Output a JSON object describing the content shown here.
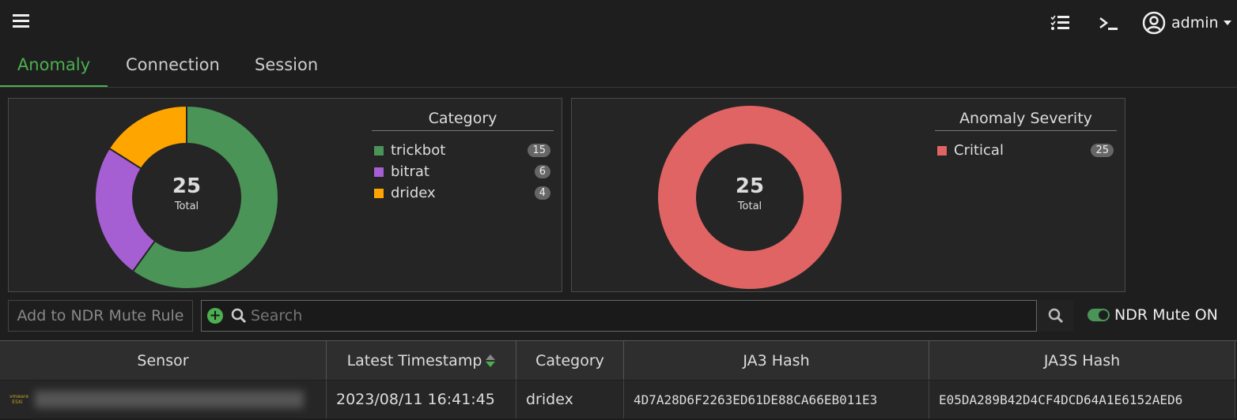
{
  "header": {
    "user": "admin"
  },
  "tabs": [
    {
      "label": "Anomaly"
    },
    {
      "label": "Connection"
    },
    {
      "label": "Session"
    }
  ],
  "category_chart": {
    "title": "Category",
    "total": "25",
    "total_label": "Total",
    "items": [
      {
        "label": "trickbot",
        "count": 15,
        "color": "#4a9458"
      },
      {
        "label": "bitrat",
        "count": 6,
        "color": "#a65fd2"
      },
      {
        "label": "dridex",
        "count": 4,
        "color": "#ffa500"
      }
    ]
  },
  "severity_chart": {
    "title": "Anomaly Severity",
    "total": "25",
    "total_label": "Total",
    "items": [
      {
        "label": "Critical",
        "count": 25,
        "color": "#e06464"
      }
    ]
  },
  "toolbar": {
    "mute_rule_button": "Add to NDR Mute Rule",
    "search_placeholder": "Search",
    "mute_toggle_label": "NDR Mute ON",
    "mute_on": true
  },
  "table": {
    "columns": [
      "Sensor",
      "Latest Timestamp",
      "Category",
      "JA3 Hash",
      "JA3S Hash"
    ],
    "rows": [
      {
        "timestamp": "2023/08/11 16:41:45",
        "category": "dridex",
        "ja3": "4D7A28D6F2263ED61DE88CA66EB011E3",
        "ja3s": "E05DA289B42D4CF4DCD64A1E6152AED6"
      }
    ]
  }
}
